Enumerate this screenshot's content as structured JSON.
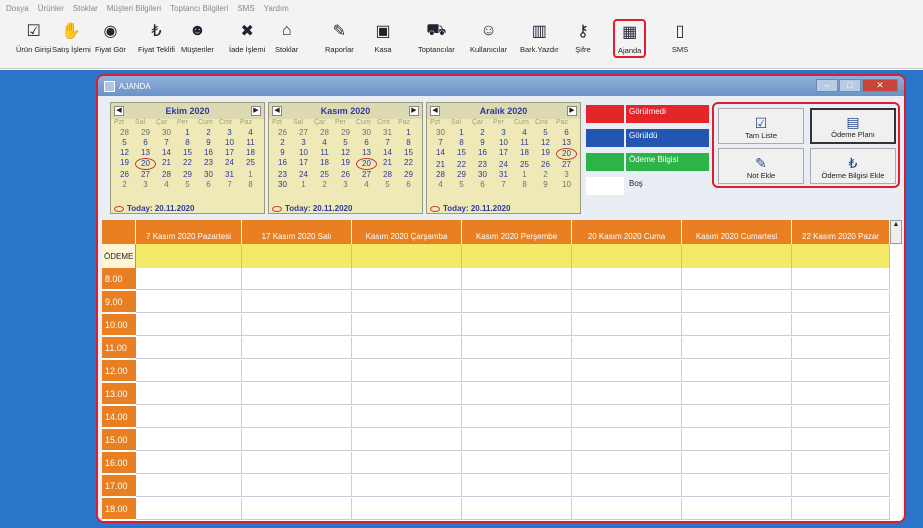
{
  "menu": [
    "Dosya",
    "Ürünler",
    "Stoklar",
    "Müşteri Bilgileri",
    "Toptancı Bilgileri",
    "SMS",
    "Yardım"
  ],
  "toolbar": [
    {
      "label": "Ürün Girişi",
      "icon": "checklist-icon"
    },
    {
      "label": "Satış İşlemi",
      "icon": "handshake-icon"
    },
    {
      "label": "Fiyat Gör",
      "icon": "eye-icon"
    },
    {
      "label": "Fiyat Teklifi",
      "icon": "lira-icon"
    },
    {
      "label": "Müşteriler",
      "icon": "customers-icon"
    },
    {
      "label": "İade İşlemi",
      "icon": "return-icon"
    },
    {
      "label": "Stoklar",
      "icon": "store-icon"
    },
    {
      "label": "Raporlar",
      "icon": "report-icon"
    },
    {
      "label": "Kasa",
      "icon": "safe-icon"
    },
    {
      "label": "Toptancılar",
      "icon": "truck-icon"
    },
    {
      "label": "Kullanıcılar",
      "icon": "users-icon"
    },
    {
      "label": "Bark.Yazdır",
      "icon": "barcode-icon"
    },
    {
      "label": "Şifre",
      "icon": "key-icon"
    },
    {
      "label": "Ajanda",
      "icon": "calendar-icon"
    },
    {
      "label": "SMS",
      "icon": "phone-icon"
    }
  ],
  "window": {
    "title": "AJANDA"
  },
  "calendars": [
    {
      "month": "Ekim 2020",
      "dayNames": [
        "Pzt",
        "Sal",
        "Çar",
        "Per",
        "Cum",
        "Cmt",
        "Paz"
      ],
      "days": [
        "28",
        "29",
        "30",
        "1",
        "2",
        "3",
        "4",
        "5",
        "6",
        "7",
        "8",
        "9",
        "10",
        "11",
        "12",
        "13",
        "14",
        "15",
        "16",
        "17",
        "18",
        "19",
        "20",
        "21",
        "22",
        "23",
        "24",
        "25",
        "26",
        "27",
        "28",
        "29",
        "30",
        "31",
        "1",
        "2",
        "3",
        "4",
        "5",
        "6",
        "7",
        "8"
      ],
      "selected": "20",
      "today": "Today: 20.11.2020"
    },
    {
      "month": "Kasım 2020",
      "dayNames": [
        "Pzt",
        "Sal",
        "Çar",
        "Per",
        "Cum",
        "Cmt",
        "Paz"
      ],
      "days": [
        "26",
        "27",
        "28",
        "29",
        "30",
        "31",
        "1",
        "2",
        "3",
        "4",
        "5",
        "6",
        "7",
        "8",
        "9",
        "10",
        "11",
        "12",
        "13",
        "14",
        "15",
        "16",
        "17",
        "18",
        "19",
        "20",
        "21",
        "22",
        "23",
        "24",
        "25",
        "26",
        "27",
        "28",
        "29",
        "30",
        "1",
        "2",
        "3",
        "4",
        "5",
        "6"
      ],
      "selected": "20",
      "today": "Today: 20.11.2020"
    },
    {
      "month": "Aralık 2020",
      "dayNames": [
        "Pzt",
        "Sal",
        "Çar",
        "Per",
        "Cum",
        "Cmt",
        "Paz"
      ],
      "days": [
        "30",
        "1",
        "2",
        "3",
        "4",
        "5",
        "6",
        "7",
        "8",
        "9",
        "10",
        "11",
        "12",
        "13",
        "14",
        "15",
        "16",
        "17",
        "18",
        "19",
        "20",
        "21",
        "22",
        "23",
        "24",
        "25",
        "26",
        "27",
        "28",
        "29",
        "30",
        "31",
        "1",
        "2",
        "3",
        "4",
        "5",
        "6",
        "7",
        "8",
        "9",
        "10"
      ],
      "selected": "20",
      "today": "Today: 20.11.2020"
    }
  ],
  "legend": [
    {
      "label": "Görülmedi",
      "color": "#e4262b"
    },
    {
      "label": "Görüldü",
      "color": "#2256b0"
    },
    {
      "label": "Ödeme Bilgisi",
      "color": "#2eb34a"
    },
    {
      "label": "Boş",
      "color": "#ffffff"
    }
  ],
  "actions": {
    "full_list": "Tam Liste",
    "payment_plan": "Ödeme Planı",
    "add_note": "Not Ekle",
    "add_payment": "Ödeme Bilgisi Ekle"
  },
  "grid": {
    "columns": [
      "7 Kasım 2020 Pazartesi",
      "17 Kasım 2020 Salı",
      "Kasım 2020 Çarşamba",
      "Kasım 2020 Perşembe",
      "20 Kasım 2020 Cuma",
      "Kasım 2020 Cumartesi",
      "22 Kasım 2020 Pazar"
    ],
    "payment_row": "ÖDEME",
    "times": [
      "8.00",
      "9.00",
      "10.00",
      "11.00",
      "12.00",
      "13.00",
      "14.00",
      "15.00",
      "16.00",
      "17.00",
      "18.00"
    ]
  }
}
